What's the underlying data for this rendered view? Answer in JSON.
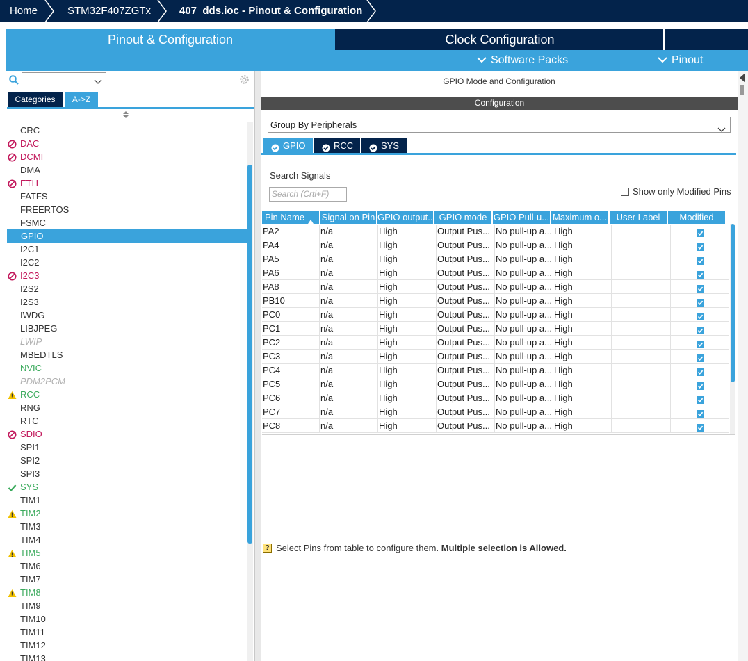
{
  "breadcrumb": [
    "Home",
    "STM32F407ZGTx",
    "407_dds.ioc - Pinout & Configuration"
  ],
  "tabs": {
    "pinout": "Pinout & Configuration",
    "clock": "Clock Configuration"
  },
  "submenus": {
    "software_packs": "Software Packs",
    "pinout": "Pinout"
  },
  "left": {
    "search_value": "",
    "categories_label": "Categories",
    "az_label": "A->Z",
    "peripherals": [
      {
        "name": "CRC",
        "state": "normal"
      },
      {
        "name": "DAC",
        "state": "error"
      },
      {
        "name": "DCMI",
        "state": "error"
      },
      {
        "name": "DMA",
        "state": "normal"
      },
      {
        "name": "ETH",
        "state": "error"
      },
      {
        "name": "FATFS",
        "state": "normal"
      },
      {
        "name": "FREERTOS",
        "state": "normal"
      },
      {
        "name": "FSMC",
        "state": "normal"
      },
      {
        "name": "GPIO",
        "state": "selected"
      },
      {
        "name": "I2C1",
        "state": "normal"
      },
      {
        "name": "I2C2",
        "state": "normal"
      },
      {
        "name": "I2C3",
        "state": "error"
      },
      {
        "name": "I2S2",
        "state": "normal"
      },
      {
        "name": "I2S3",
        "state": "normal"
      },
      {
        "name": "IWDG",
        "state": "normal"
      },
      {
        "name": "LIBJPEG",
        "state": "normal"
      },
      {
        "name": "LWIP",
        "state": "disabled"
      },
      {
        "name": "MBEDTLS",
        "state": "normal"
      },
      {
        "name": "NVIC",
        "state": "ok-text"
      },
      {
        "name": "PDM2PCM",
        "state": "disabled"
      },
      {
        "name": "RCC",
        "state": "warning"
      },
      {
        "name": "RNG",
        "state": "normal"
      },
      {
        "name": "RTC",
        "state": "normal"
      },
      {
        "name": "SDIO",
        "state": "error"
      },
      {
        "name": "SPI1",
        "state": "normal"
      },
      {
        "name": "SPI2",
        "state": "normal"
      },
      {
        "name": "SPI3",
        "state": "normal"
      },
      {
        "name": "SYS",
        "state": "ok"
      },
      {
        "name": "TIM1",
        "state": "normal"
      },
      {
        "name": "TIM2",
        "state": "warning"
      },
      {
        "name": "TIM3",
        "state": "normal"
      },
      {
        "name": "TIM4",
        "state": "normal"
      },
      {
        "name": "TIM5",
        "state": "warning"
      },
      {
        "name": "TIM6",
        "state": "normal"
      },
      {
        "name": "TIM7",
        "state": "normal"
      },
      {
        "name": "TIM8",
        "state": "warning"
      },
      {
        "name": "TIM9",
        "state": "normal"
      },
      {
        "name": "TIM10",
        "state": "normal"
      },
      {
        "name": "TIM11",
        "state": "normal"
      },
      {
        "name": "TIM12",
        "state": "normal"
      },
      {
        "name": "TIM13",
        "state": "normal"
      }
    ]
  },
  "right": {
    "title": "GPIO Mode and Configuration",
    "config_label": "Configuration",
    "group_by": "Group By Peripherals",
    "ptabs": [
      "GPIO",
      "RCC",
      "SYS"
    ],
    "search_signals_label": "Search Signals",
    "search_placeholder": "Search (Crtl+F)",
    "show_modified_label": "Show only Modified Pins",
    "columns": [
      "Pin Name",
      "Signal on Pin",
      "GPIO output...",
      "GPIO mode",
      "GPIO Pull-u...",
      "Maximum o...",
      "User Label",
      "Modified"
    ],
    "rows": [
      [
        "PA2",
        "n/a",
        "High",
        "Output Pus...",
        "No pull-up a...",
        "High",
        "",
        true
      ],
      [
        "PA4",
        "n/a",
        "High",
        "Output Pus...",
        "No pull-up a...",
        "High",
        "",
        true
      ],
      [
        "PA5",
        "n/a",
        "High",
        "Output Pus...",
        "No pull-up a...",
        "High",
        "",
        true
      ],
      [
        "PA6",
        "n/a",
        "High",
        "Output Pus...",
        "No pull-up a...",
        "High",
        "",
        true
      ],
      [
        "PA8",
        "n/a",
        "High",
        "Output Pus...",
        "No pull-up a...",
        "High",
        "",
        true
      ],
      [
        "PB10",
        "n/a",
        "High",
        "Output Pus...",
        "No pull-up a...",
        "High",
        "",
        true
      ],
      [
        "PC0",
        "n/a",
        "High",
        "Output Pus...",
        "No pull-up a...",
        "High",
        "",
        true
      ],
      [
        "PC1",
        "n/a",
        "High",
        "Output Pus...",
        "No pull-up a...",
        "High",
        "",
        true
      ],
      [
        "PC2",
        "n/a",
        "High",
        "Output Pus...",
        "No pull-up a...",
        "High",
        "",
        true
      ],
      [
        "PC3",
        "n/a",
        "High",
        "Output Pus...",
        "No pull-up a...",
        "High",
        "",
        true
      ],
      [
        "PC4",
        "n/a",
        "High",
        "Output Pus...",
        "No pull-up a...",
        "High",
        "",
        true
      ],
      [
        "PC5",
        "n/a",
        "High",
        "Output Pus...",
        "No pull-up a...",
        "High",
        "",
        true
      ],
      [
        "PC6",
        "n/a",
        "High",
        "Output Pus...",
        "No pull-up a...",
        "High",
        "",
        true
      ],
      [
        "PC7",
        "n/a",
        "High",
        "Output Pus...",
        "No pull-up a...",
        "High",
        "",
        true
      ],
      [
        "PC8",
        "n/a",
        "High",
        "Output Pus...",
        "No pull-up a...",
        "High",
        "",
        true
      ]
    ],
    "hint_text": "Select Pins from table to configure them.",
    "hint_bold": "Multiple selection is Allowed."
  },
  "colors": {
    "navy": "#03234b",
    "accent": "#3aa3dc",
    "error": "#c2185b",
    "ok": "#3aaa5c",
    "warning": "#f2c200"
  }
}
